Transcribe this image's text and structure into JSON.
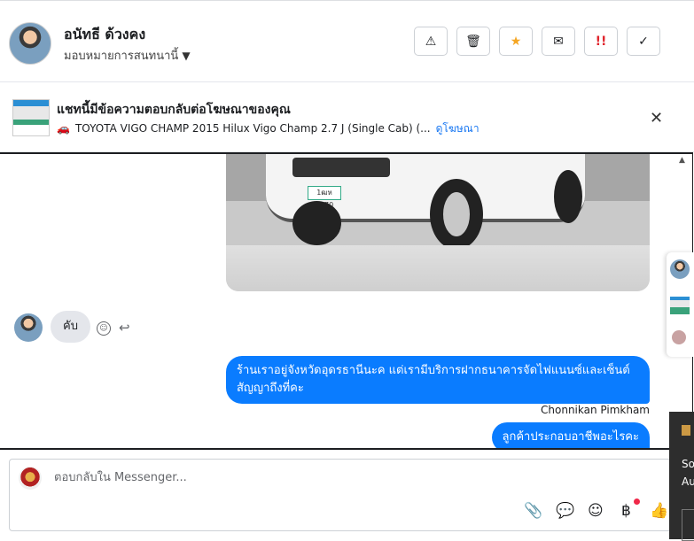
{
  "header": {
    "contact_name": "อนัทธี ด้วงคง",
    "assign_label": "มอบหมายการสนทนานี้",
    "buttons": [
      {
        "name": "report-spam-button",
        "glyph": "⚠"
      },
      {
        "name": "delete-button",
        "glyph": "🗑"
      },
      {
        "name": "star-button",
        "glyph": "★"
      },
      {
        "name": "mark-unread-button",
        "glyph": "✉"
      },
      {
        "name": "follow-up-button",
        "glyph": "!!"
      },
      {
        "name": "mark-done-button",
        "glyph": "✓"
      }
    ]
  },
  "ad_banner": {
    "title": "แชทนี้มีข้อความตอบกลับต่อโฆษณาของคุณ",
    "subtitle": "TOYOTA VIGO CHAMP 2015 Hilux Vigo Champ 2.7 J (Single Cab) (...",
    "link": "ดูโฆษณา",
    "close_glyph": "✕"
  },
  "conversation": {
    "image_plate": "1ฒห 9570",
    "received_message": "คับ",
    "sent_message_1": "ร้านเราอยู่จังหวัดอุดรธานีนะค แต่เรามีบริการฝากธนาคารจัดไฟแนนซ์และเซ็นต์สัญญาถึงที่คะ",
    "sender_name": "Chonnikan Pimkham",
    "sent_message_2": "ลูกค้าประกอบอาชีพอะไรคะ"
  },
  "composer": {
    "placeholder": "ตอบกลับใน Messenger...",
    "icons": [
      "paperclip-icon",
      "chat-bubble-icon",
      "emoji-icon",
      "baht-icon",
      "thumbs-up-icon"
    ]
  },
  "overlay": {
    "panel_text_1": "So",
    "panel_text_2": "Au"
  },
  "colors": {
    "accent": "#0a7cff",
    "link": "#1877f2",
    "star": "#f5a623",
    "alert": "#e0242c"
  }
}
